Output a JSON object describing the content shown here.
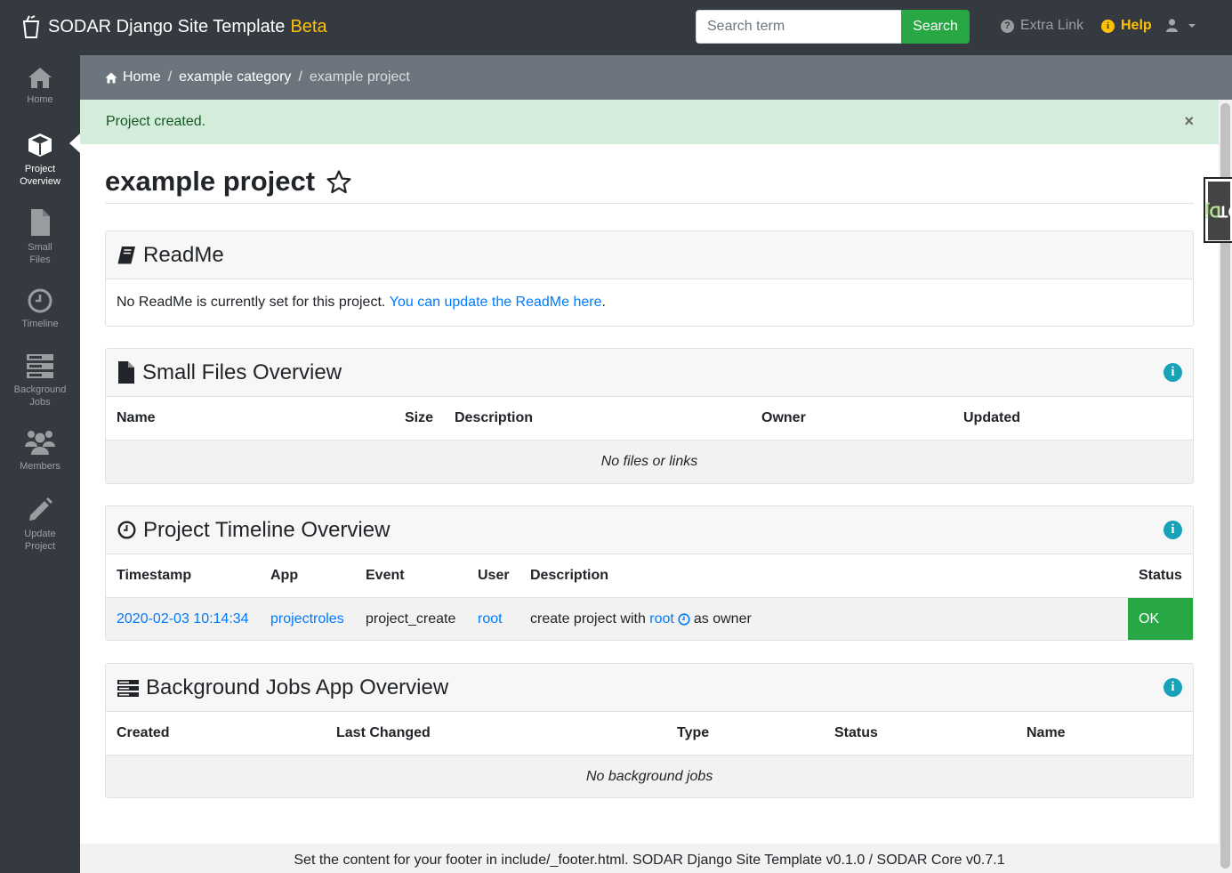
{
  "navbar": {
    "brand": "SODAR Django Site Template",
    "beta": "Beta",
    "search_placeholder": "Search term",
    "search_button": "Search",
    "extra_link": "Extra Link",
    "help": "Help"
  },
  "sidebar": {
    "items": [
      {
        "label": "Home",
        "icon": "home-icon"
      },
      {
        "label": "Project Overview",
        "icon": "cube-icon"
      },
      {
        "label": "Small Files",
        "icon": "file-icon"
      },
      {
        "label": "Timeline",
        "icon": "clock-icon"
      },
      {
        "label": "Background Jobs",
        "icon": "server-icon"
      },
      {
        "label": "Members",
        "icon": "users-icon"
      },
      {
        "label": "Update Project",
        "icon": "pencil-icon"
      }
    ]
  },
  "breadcrumb": {
    "home": "Home",
    "category": "example category",
    "project": "example project"
  },
  "alert": {
    "message": "Project created.",
    "close": "×"
  },
  "page": {
    "title": "example project"
  },
  "readme": {
    "title": "ReadMe",
    "text": "No ReadMe is currently set for this project.",
    "link": "You can update the ReadMe here",
    "trailing": "."
  },
  "small_files": {
    "title": "Small Files Overview",
    "columns": [
      "Name",
      "Size",
      "Description",
      "Owner",
      "Updated"
    ],
    "empty": "No files or links"
  },
  "timeline": {
    "title": "Project Timeline Overview",
    "columns": [
      "Timestamp",
      "App",
      "Event",
      "User",
      "Description",
      "Status"
    ],
    "rows": [
      {
        "timestamp": "2020-02-03 10:14:34",
        "app": "projectroles",
        "event": "project_create",
        "user": "root",
        "description_prefix": "create project with",
        "description_user": "root",
        "description_suffix": "as owner",
        "status": "OK"
      }
    ]
  },
  "bgjobs": {
    "title": "Background Jobs App Overview",
    "columns": [
      "Created",
      "Last Changed",
      "Type",
      "Status",
      "Name"
    ],
    "empty": "No background jobs"
  },
  "footer": {
    "text": "Set the content for your footer in include/_footer.html. SODAR Django Site Template v0.1.0 / SODAR Core v0.7.1"
  },
  "djdt": {
    "dj": "Dj",
    "dt": "DT"
  },
  "colors": {
    "navbar": "#343a40",
    "brand_beta": "#ffc107",
    "search_button": "#28a745",
    "breadcrumb": "#6c757d",
    "alert_bg": "#d4edda",
    "alert_text": "#155724",
    "link": "#007bff",
    "info": "#17a2b8",
    "status_ok": "#28a745"
  }
}
